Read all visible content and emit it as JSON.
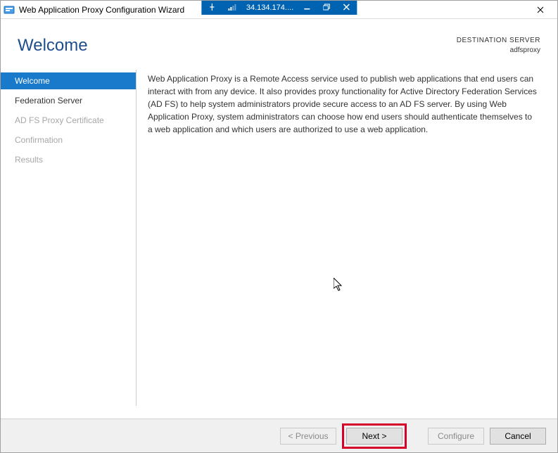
{
  "window": {
    "title": "Web Application Proxy Configuration Wizard"
  },
  "rdp": {
    "ip": "34.134.174...."
  },
  "header": {
    "heading": "Welcome",
    "dest_label": "DESTINATION SERVER",
    "dest_name": "adfsproxy"
  },
  "sidebar": {
    "steps": [
      {
        "label": "Welcome",
        "state": "active"
      },
      {
        "label": "Federation Server",
        "state": "enabled"
      },
      {
        "label": "AD FS Proxy Certificate",
        "state": "disabled"
      },
      {
        "label": "Confirmation",
        "state": "disabled"
      },
      {
        "label": "Results",
        "state": "disabled"
      }
    ]
  },
  "main": {
    "body": "Web Application Proxy is a Remote Access service used to publish web applications that end users can interact with from any device. It also provides proxy functionality for Active Directory Federation Services (AD FS) to help system administrators provide secure access to an AD FS server. By using Web Application Proxy, system administrators can choose how end users should authenticate themselves to a web application and which users are authorized to use a web application."
  },
  "footer": {
    "previous": "< Previous",
    "next": "Next >",
    "configure": "Configure",
    "cancel": "Cancel"
  }
}
